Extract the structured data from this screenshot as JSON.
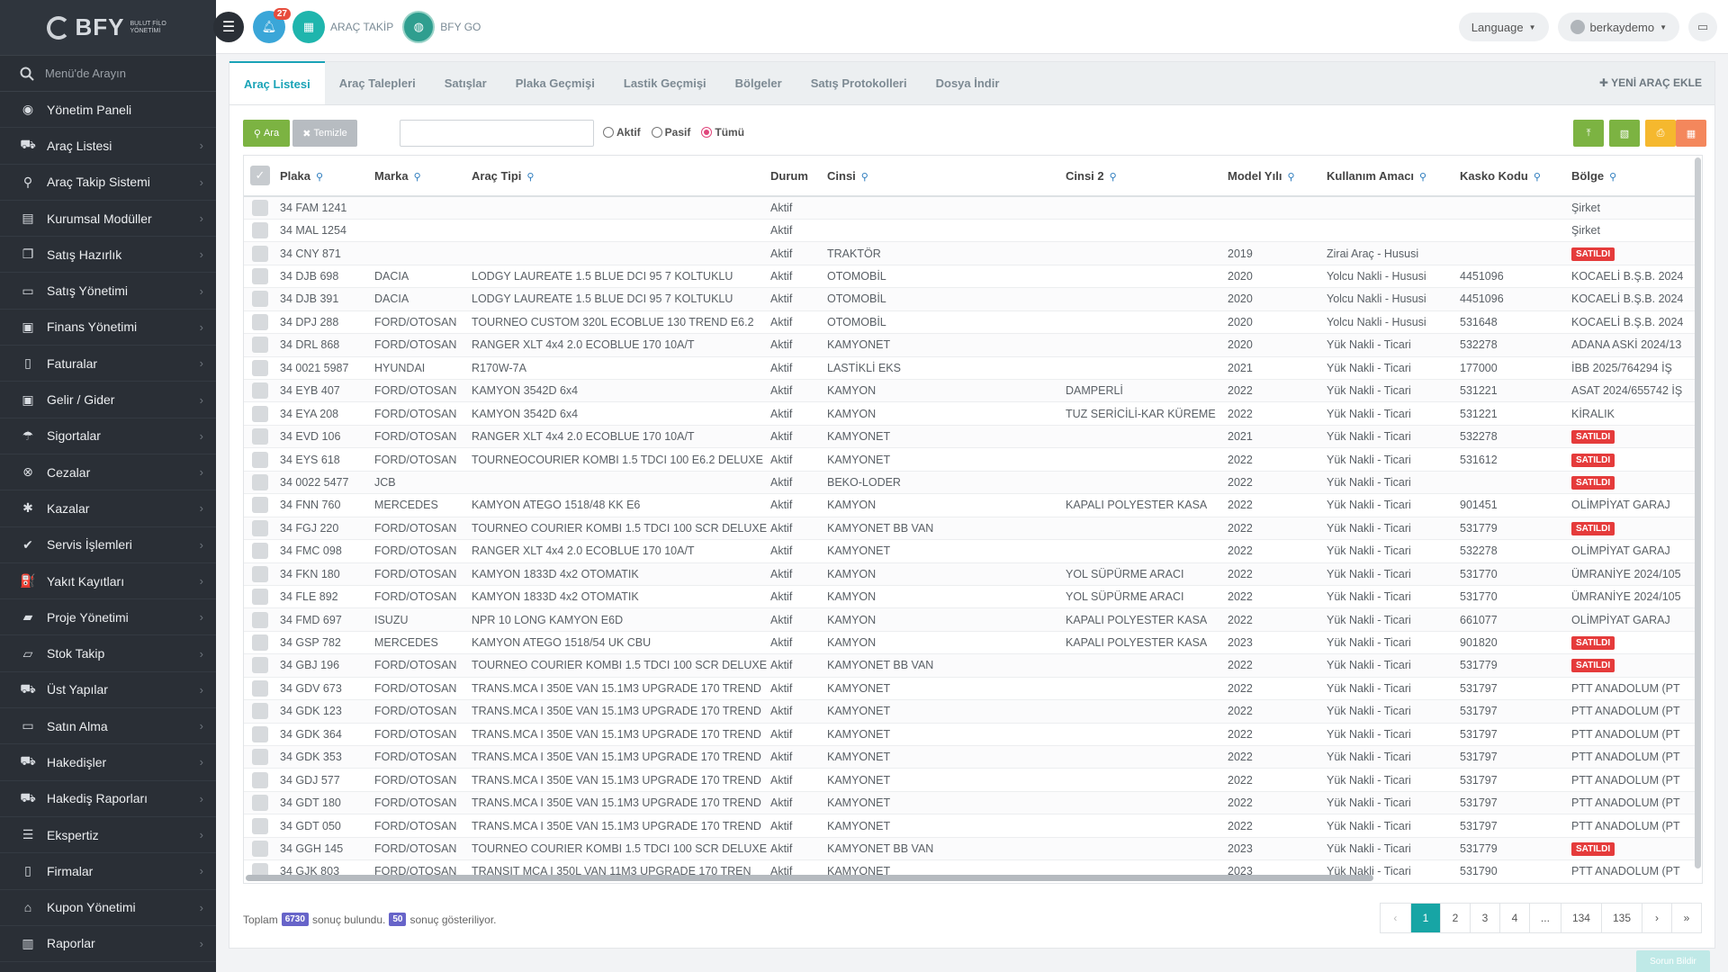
{
  "brand": {
    "name": "BFY",
    "subtitle": "BULUT FİLO YÖNETİMİ"
  },
  "sidebar": {
    "search_placeholder": "Menü'de Arayın",
    "items": [
      {
        "label": "Yönetim Paneli",
        "icon": "dashboard-icon",
        "glyph": "◉"
      },
      {
        "label": "Araç Listesi",
        "icon": "car-icon",
        "glyph": "⛟"
      },
      {
        "label": "Araç Takip Sistemi",
        "icon": "map-pin-icon",
        "glyph": "⚲"
      },
      {
        "label": "Kurumsal Modüller",
        "icon": "building-icon",
        "glyph": "▤"
      },
      {
        "label": "Satış Hazırlık",
        "icon": "book-icon",
        "glyph": "❐"
      },
      {
        "label": "Satış Yönetimi",
        "icon": "credit-card-icon",
        "glyph": "▭"
      },
      {
        "label": "Finans Yönetimi",
        "icon": "money-icon",
        "glyph": "▣"
      },
      {
        "label": "Faturalar",
        "icon": "file-icon",
        "glyph": "▯"
      },
      {
        "label": "Gelir / Gider",
        "icon": "money-icon",
        "glyph": "▣"
      },
      {
        "label": "Sigortalar",
        "icon": "umbrella-icon",
        "glyph": "☂"
      },
      {
        "label": "Cezalar",
        "icon": "close-circle-icon",
        "glyph": "⊗"
      },
      {
        "label": "Kazalar",
        "icon": "car-crash-icon",
        "glyph": "✱"
      },
      {
        "label": "Servis İşlemleri",
        "icon": "check-circle-icon",
        "glyph": "✔"
      },
      {
        "label": "Yakıt Kayıtları",
        "icon": "fuel-icon",
        "glyph": "⛽"
      },
      {
        "label": "Proje Yönetimi",
        "icon": "briefcase-icon",
        "glyph": "▰"
      },
      {
        "label": "Stok Takip",
        "icon": "inbox-icon",
        "glyph": "▱"
      },
      {
        "label": "Üst Yapılar",
        "icon": "truck-icon",
        "glyph": "⛟"
      },
      {
        "label": "Satın Alma",
        "icon": "credit-card-icon",
        "glyph": "▭"
      },
      {
        "label": "Hakedişler",
        "icon": "truck-icon",
        "glyph": "⛟"
      },
      {
        "label": "Hakediş Raporları",
        "icon": "truck-icon",
        "glyph": "⛟"
      },
      {
        "label": "Ekspertiz",
        "icon": "list-icon",
        "glyph": "☰"
      },
      {
        "label": "Firmalar",
        "icon": "file-icon",
        "glyph": "▯"
      },
      {
        "label": "Kupon Yönetimi",
        "icon": "tag-icon",
        "glyph": "⌂"
      },
      {
        "label": "Raporlar",
        "icon": "bar-chart-icon",
        "glyph": "▥"
      }
    ]
  },
  "topbar": {
    "notification_count": "27",
    "link1": "ARAÇ TAKİP",
    "link2": "BFY GO",
    "language": "Language",
    "user": "berkaydemo"
  },
  "tabs": [
    "Araç Listesi",
    "Araç Talepleri",
    "Satışlar",
    "Plaka Geçmişi",
    "Lastik Geçmişi",
    "Bölgeler",
    "Satış Protokolleri",
    "Dosya İndir"
  ],
  "new_vehicle_label": "YENİ ARAÇ EKLE",
  "toolbar": {
    "search_label": "Ara",
    "clear_label": "Temizle",
    "radio_active": "Aktif",
    "radio_passive": "Pasif",
    "radio_all": "Tümü",
    "colors": {
      "green": "#7cb342",
      "amber": "#f5b82e",
      "orange": "#f4875c",
      "clear": "#b7bcc1"
    }
  },
  "table": {
    "headers": [
      "Plaka",
      "Marka",
      "Araç Tipi",
      "Durum",
      "Cinsi",
      "Cinsi 2",
      "Model Yılı",
      "Kullanım Amacı",
      "Kasko Kodu",
      "Bölge"
    ],
    "rows": [
      [
        "34 FAM 1241",
        "",
        "",
        "Aktif",
        "",
        "",
        "",
        "",
        "",
        "Şirket"
      ],
      [
        "34 MAL 1254",
        "",
        "",
        "Aktif",
        "",
        "",
        "",
        "",
        "",
        "Şirket"
      ],
      [
        "34 CNY 871",
        "",
        "",
        "Aktif",
        "TRAKTÖR",
        "",
        "2019",
        "Zirai Araç - Hususi",
        "",
        "SATILDI"
      ],
      [
        "34 DJB 698",
        "DACIA",
        "LODGY LAUREATE 1.5 BLUE DCI 95 7 KOLTUKLU",
        "Aktif",
        "OTOMOBİL",
        "",
        "2020",
        "Yolcu Nakli - Hususi",
        "4451096",
        "KOCAELİ B.Ş.B. 2024"
      ],
      [
        "34 DJB 391",
        "DACIA",
        "LODGY LAUREATE 1.5 BLUE DCI 95 7 KOLTUKLU",
        "Aktif",
        "OTOMOBİL",
        "",
        "2020",
        "Yolcu Nakli - Hususi",
        "4451096",
        "KOCAELİ B.Ş.B. 2024"
      ],
      [
        "34 DPJ 288",
        "FORD/OTOSAN",
        "TOURNEO CUSTOM 320L ECOBLUE 130 TREND E6.2",
        "Aktif",
        "OTOMOBİL",
        "",
        "2020",
        "Yolcu Nakli - Hususi",
        "531648",
        "KOCAELİ B.Ş.B. 2024"
      ],
      [
        "34 DRL 868",
        "FORD/OTOSAN",
        "RANGER XLT 4x4 2.0 ECOBLUE 170 10A/T",
        "Aktif",
        "KAMYONET",
        "",
        "2020",
        "Yük Nakli - Ticari",
        "532278",
        "ADANA ASKİ 2024/13"
      ],
      [
        "34 0021 5987",
        "HYUNDAI",
        "R170W-7A",
        "Aktif",
        "LASTİKLİ EKS",
        "",
        "2021",
        "Yük Nakli - Ticari",
        "177000",
        "İBB 2025/764294 İŞ"
      ],
      [
        "34 EYB 407",
        "FORD/OTOSAN",
        "KAMYON 3542D 6x4",
        "Aktif",
        "KAMYON",
        "DAMPERLİ",
        "2022",
        "Yük Nakli - Ticari",
        "531221",
        "ASAT 2024/655742 İŞ"
      ],
      [
        "34 EYA 208",
        "FORD/OTOSAN",
        "KAMYON 3542D 6x4",
        "Aktif",
        "KAMYON",
        "TUZ SERİCİLİ-KAR KÜREME",
        "2022",
        "Yük Nakli - Ticari",
        "531221",
        "KİRALIK"
      ],
      [
        "34 EVD 106",
        "FORD/OTOSAN",
        "RANGER XLT 4x4 2.0 ECOBLUE 170 10A/T",
        "Aktif",
        "KAMYONET",
        "",
        "2021",
        "Yük Nakli - Ticari",
        "532278",
        "SATILDI"
      ],
      [
        "34 EYS 618",
        "FORD/OTOSAN",
        "TOURNEOCOURIER KOMBI 1.5 TDCI 100 E6.2 DELUXE",
        "Aktif",
        "KAMYONET",
        "",
        "2022",
        "Yük Nakli - Ticari",
        "531612",
        "SATILDI"
      ],
      [
        "34 0022 5477",
        "JCB",
        "",
        "Aktif",
        "BEKO-LODER",
        "",
        "2022",
        "Yük Nakli - Ticari",
        "",
        "SATILDI"
      ],
      [
        "34 FNN 760",
        "MERCEDES",
        "KAMYON ATEGO 1518/48 KK E6",
        "Aktif",
        "KAMYON",
        "KAPALI POLYESTER KASA",
        "2022",
        "Yük Nakli - Ticari",
        "901451",
        "OLİMPİYAT GARAJ"
      ],
      [
        "34 FGJ 220",
        "FORD/OTOSAN",
        "TOURNEO COURIER KOMBI 1.5 TDCI 100 SCR DELUXE",
        "Aktif",
        "KAMYONET BB VAN",
        "",
        "2022",
        "Yük Nakli - Ticari",
        "531779",
        "SATILDI"
      ],
      [
        "34 FMC 098",
        "FORD/OTOSAN",
        "RANGER XLT 4x4 2.0 ECOBLUE 170 10A/T",
        "Aktif",
        "KAMYONET",
        "",
        "2022",
        "Yük Nakli - Ticari",
        "532278",
        "OLİMPİYAT GARAJ"
      ],
      [
        "34 FKN 180",
        "FORD/OTOSAN",
        "KAMYON 1833D 4x2 OTOMATIK",
        "Aktif",
        "KAMYON",
        "YOL SÜPÜRME ARACI",
        "2022",
        "Yük Nakli - Ticari",
        "531770",
        "ÜMRANİYE 2024/105"
      ],
      [
        "34 FLE 892",
        "FORD/OTOSAN",
        "KAMYON 1833D 4x2 OTOMATIK",
        "Aktif",
        "KAMYON",
        "YOL SÜPÜRME ARACI",
        "2022",
        "Yük Nakli - Ticari",
        "531770",
        "ÜMRANİYE 2024/105"
      ],
      [
        "34 FMD 697",
        "ISUZU",
        "NPR 10 LONG KAMYON E6D",
        "Aktif",
        "KAMYON",
        "KAPALI POLYESTER KASA",
        "2022",
        "Yük Nakli - Ticari",
        "661077",
        "OLİMPİYAT GARAJ"
      ],
      [
        "34 GSP 782",
        "MERCEDES",
        "KAMYON ATEGO 1518/54 UK CBU",
        "Aktif",
        "KAMYON",
        "KAPALI POLYESTER KASA",
        "2023",
        "Yük Nakli - Ticari",
        "901820",
        "SATILDI"
      ],
      [
        "34 GBJ 196",
        "FORD/OTOSAN",
        "TOURNEO COURIER KOMBI 1.5 TDCI 100 SCR DELUXE",
        "Aktif",
        "KAMYONET BB VAN",
        "",
        "2022",
        "Yük Nakli - Ticari",
        "531779",
        "SATILDI"
      ],
      [
        "34 GDV 673",
        "FORD/OTOSAN",
        "TRANS.MCA I 350E VAN 15.1M3 UPGRADE 170 TREND",
        "Aktif",
        "KAMYONET",
        "",
        "2022",
        "Yük Nakli - Ticari",
        "531797",
        "PTT ANADOLUM (PT"
      ],
      [
        "34 GDK 123",
        "FORD/OTOSAN",
        "TRANS.MCA I 350E VAN 15.1M3 UPGRADE 170 TREND",
        "Aktif",
        "KAMYONET",
        "",
        "2022",
        "Yük Nakli - Ticari",
        "531797",
        "PTT ANADOLUM (PT"
      ],
      [
        "34 GDK 364",
        "FORD/OTOSAN",
        "TRANS.MCA I 350E VAN 15.1M3 UPGRADE 170 TREND",
        "Aktif",
        "KAMYONET",
        "",
        "2022",
        "Yük Nakli - Ticari",
        "531797",
        "PTT ANADOLUM (PT"
      ],
      [
        "34 GDK 353",
        "FORD/OTOSAN",
        "TRANS.MCA I 350E VAN 15.1M3 UPGRADE 170 TREND",
        "Aktif",
        "KAMYONET",
        "",
        "2022",
        "Yük Nakli - Ticari",
        "531797",
        "PTT ANADOLUM (PT"
      ],
      [
        "34 GDJ 577",
        "FORD/OTOSAN",
        "TRANS.MCA I 350E VAN 15.1M3 UPGRADE 170 TREND",
        "Aktif",
        "KAMYONET",
        "",
        "2022",
        "Yük Nakli - Ticari",
        "531797",
        "PTT ANADOLUM (PT"
      ],
      [
        "34 GDT 180",
        "FORD/OTOSAN",
        "TRANS.MCA I 350E VAN 15.1M3 UPGRADE 170 TREND",
        "Aktif",
        "KAMYONET",
        "",
        "2022",
        "Yük Nakli - Ticari",
        "531797",
        "PTT ANADOLUM (PT"
      ],
      [
        "34 GDT 050",
        "FORD/OTOSAN",
        "TRANS.MCA I 350E VAN 15.1M3 UPGRADE 170 TREND",
        "Aktif",
        "KAMYONET",
        "",
        "2022",
        "Yük Nakli - Ticari",
        "531797",
        "PTT ANADOLUM (PT"
      ],
      [
        "34 GGH 145",
        "FORD/OTOSAN",
        "TOURNEO COURIER KOMBI 1.5 TDCI 100 SCR DELUXE",
        "Aktif",
        "KAMYONET BB VAN",
        "",
        "2023",
        "Yük Nakli - Ticari",
        "531779",
        "SATILDI"
      ],
      [
        "34 GJK 803",
        "FORD/OTOSAN",
        "TRANSIT MCA I 350L VAN 11M3 UPGRADE 170 TREN",
        "Aktif",
        "KAMYONET",
        "",
        "2023",
        "Yük Nakli - Ticari",
        "531790",
        "PTT ANADOLUM (PT"
      ]
    ]
  },
  "summary": {
    "prefix": "Toplam",
    "total": "6730",
    "mid": "sonuç bulundu.",
    "shown": "50",
    "suffix": "sonuç gösteriliyor."
  },
  "pagination": [
    "‹",
    "1",
    "2",
    "3",
    "4",
    "...",
    "134",
    "135",
    "›",
    "»"
  ],
  "report_label": "Sorun Bildir"
}
